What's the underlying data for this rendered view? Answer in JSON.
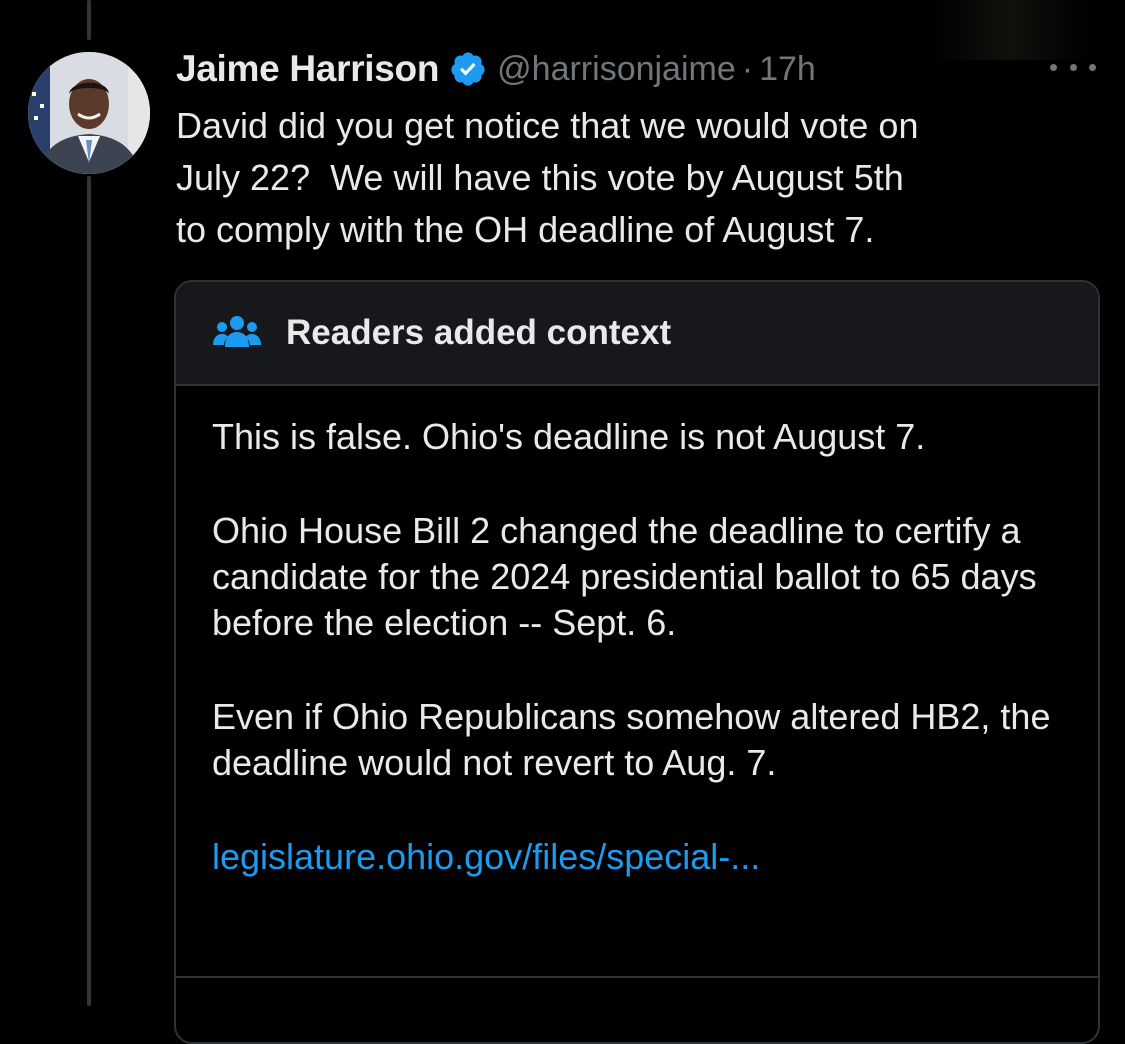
{
  "tweet": {
    "display_name": "Jaime Harrison",
    "handle": "@harrisonjaime",
    "separator": "·",
    "time": "17h",
    "text": "David did you get notice that we would vote on\nJuly 22?  We will have this vote by August 5th\nto comply with the OH deadline of August 7."
  },
  "community_note": {
    "title": "Readers added context",
    "paragraph_1": "This is false. Ohio's deadline is not August 7.",
    "paragraph_2": "Ohio House Bill 2 changed the deadline to certify a candidate for the 2024 presidential ballot to 65 days before the election -- Sept. 6.",
    "paragraph_3": "Even if Ohio Republicans somehow altered HB2, the deadline would not revert to Aug. 7.",
    "link_text": "legislature.ohio.gov/files/special-..."
  },
  "icons": {
    "verified": "verified-badge-icon",
    "more": "more-options-icon",
    "note": "people-group-icon"
  },
  "colors": {
    "background": "#000000",
    "primary_text": "#e7e9ea",
    "secondary_text": "#71767b",
    "accent": "#1d9bf0",
    "border": "#2f3336",
    "note_header_bg": "#16181c"
  }
}
